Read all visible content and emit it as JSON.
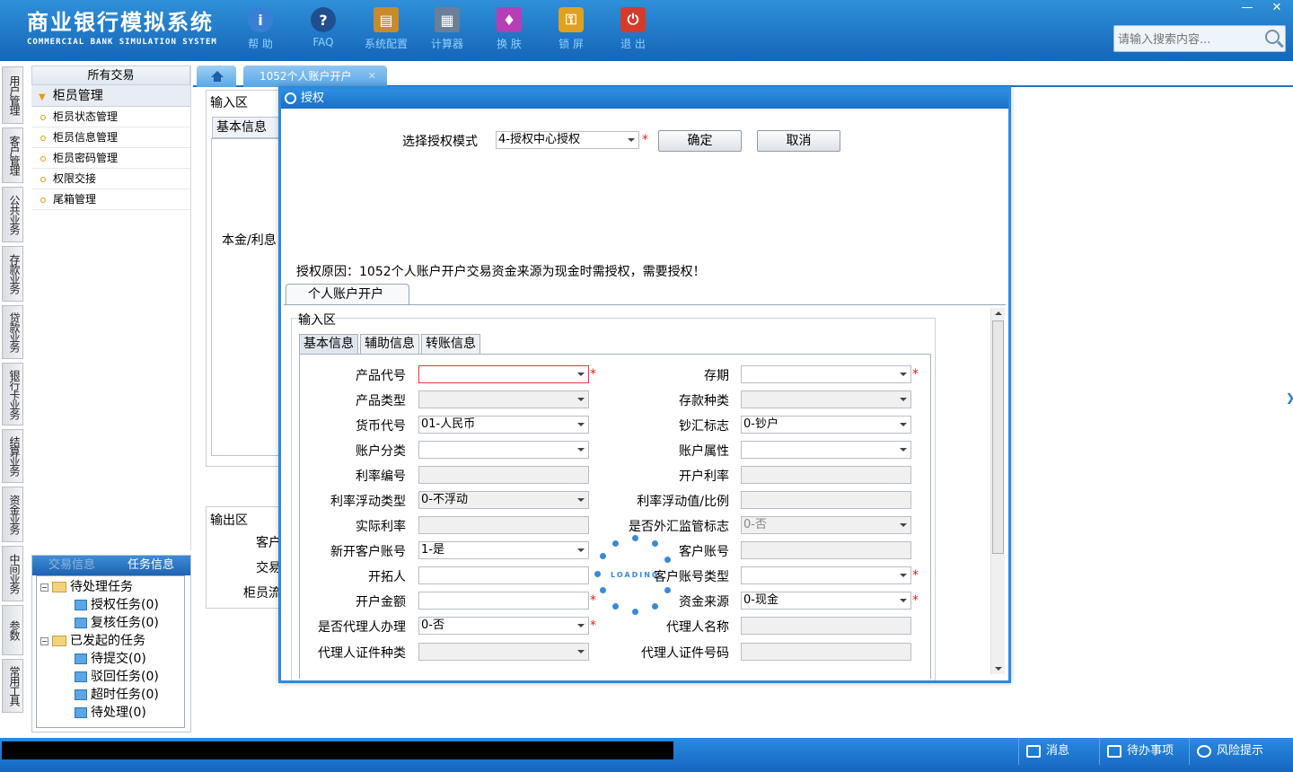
{
  "app": {
    "title_cn": "商业银行模拟系统",
    "title_en": "COMMERCIAL BANK SIMULATION SYSTEM",
    "toolbar": [
      {
        "label": "帮 助",
        "icon": "info-icon",
        "color": "#3a7fd6"
      },
      {
        "label": "FAQ",
        "icon": "faq-icon",
        "color": "#1f4f8f"
      },
      {
        "label": "系统配置",
        "icon": "toolbox-icon",
        "color": "#c98a2a"
      },
      {
        "label": "计算器",
        "icon": "calculator-icon",
        "color": "#6b7f99"
      },
      {
        "label": "换 肤",
        "icon": "skin-icon",
        "color": "#b53fb5"
      },
      {
        "label": "锁 屏",
        "icon": "lock-icon",
        "color": "#e0a020"
      },
      {
        "label": "退 出",
        "icon": "power-icon",
        "color": "#d43b2b"
      }
    ],
    "search_placeholder": "请输入搜索内容...",
    "window_controls": {
      "minimize": "—",
      "close": "✕"
    }
  },
  "left_nav": [
    "用户管理",
    "客户管理",
    "公共业务",
    "存款业务",
    "贷款业务",
    "银行卡业务",
    "结算业务",
    "资金业务",
    "中间业务",
    "参数",
    "常用工具"
  ],
  "side_menu": {
    "header": "所有交易",
    "group": "柜员管理",
    "items": [
      "柜员状态管理",
      "柜员信息管理",
      "柜员密码管理",
      "权限交接",
      "尾箱管理"
    ]
  },
  "task_panel": {
    "tabs": [
      "交易信息",
      "任务信息"
    ],
    "groups": [
      {
        "label": "待处理任务",
        "children": [
          "授权任务(0)",
          "复核任务(0)"
        ]
      },
      {
        "label": "已发起的任务",
        "children": [
          "待提交(0)",
          "驳回任务(0)",
          "超时任务(0)",
          "待处理(0)"
        ]
      }
    ]
  },
  "tabs": {
    "active": "1052个人账户开户"
  },
  "background": {
    "input_area": "输入区",
    "basic_tab": "基本信息",
    "principal_label": "本金/利息",
    "output_area": "输出区",
    "out_labels": [
      "客户",
      "交易",
      "柜员流"
    ]
  },
  "dialog": {
    "title": "授权",
    "mode_label": "选择授权模式",
    "mode_value": "4-授权中心授权",
    "confirm": "确定",
    "cancel": "取消",
    "reason": "授权原因：1052个人账户开户交易资金来源为现金时需授权，需要授权！",
    "inner_tab": "个人账户开户",
    "input_area": "输入区",
    "sub_tabs": [
      "基本信息",
      "辅助信息",
      "转账信息"
    ],
    "fields": {
      "product_code": {
        "label": "产品代号",
        "value": ""
      },
      "term": {
        "label": "存期",
        "value": ""
      },
      "product_type": {
        "label": "产品类型",
        "value": ""
      },
      "deposit_kind": {
        "label": "存款种类",
        "value": ""
      },
      "currency": {
        "label": "货币代号",
        "value": "01-人民币"
      },
      "cash_flag": {
        "label": "钞汇标志",
        "value": "0-钞户"
      },
      "acct_category": {
        "label": "账户分类",
        "value": ""
      },
      "acct_attr": {
        "label": "账户属性",
        "value": ""
      },
      "rate_no": {
        "label": "利率编号",
        "value": ""
      },
      "open_rate": {
        "label": "开户利率",
        "value": ""
      },
      "float_type": {
        "label": "利率浮动类型",
        "value": "0-不浮动"
      },
      "float_value": {
        "label": "利率浮动值/比例",
        "value": ""
      },
      "actual_rate": {
        "label": "实际利率",
        "value": ""
      },
      "fx_flag": {
        "label": "是否外汇监管标志",
        "value": "0-否"
      },
      "new_cust_acct": {
        "label": "新开客户账号",
        "value": "1-是"
      },
      "cust_acct": {
        "label": "客户账号",
        "value": ""
      },
      "developer": {
        "label": "开拓人",
        "value": ""
      },
      "cust_acct_type": {
        "label": "客户账号类型",
        "value": ""
      },
      "open_amount": {
        "label": "开户金额",
        "value": ""
      },
      "fund_source": {
        "label": "资金来源",
        "value": "0-现金"
      },
      "agent": {
        "label": "是否代理人办理",
        "value": "0-否"
      },
      "agent_name": {
        "label": "代理人名称",
        "value": ""
      },
      "agent_id_type": {
        "label": "代理人证件种类",
        "value": ""
      },
      "agent_id_no": {
        "label": "代理人证件号码",
        "value": ""
      }
    },
    "loading_text": "LOADING"
  },
  "statusbar": {
    "message": "消息",
    "todo": "待办事项",
    "risk": "风险提示"
  },
  "colors": {
    "header": "#1f75c6",
    "accent": "#2a8ae0",
    "required": "#dd2222"
  }
}
